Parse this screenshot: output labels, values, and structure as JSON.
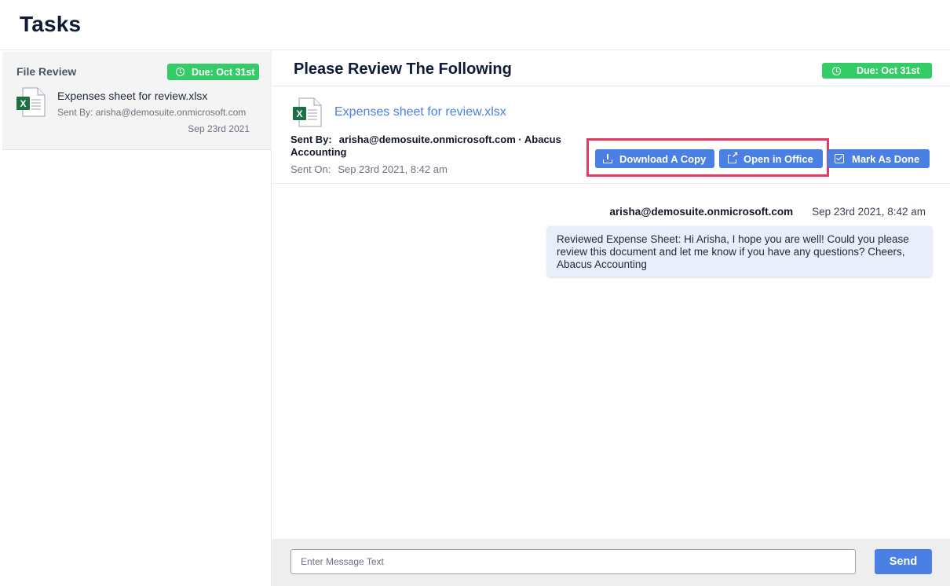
{
  "page": {
    "title": "Tasks"
  },
  "colors": {
    "accent": "#4a7fe4",
    "due_badge": "#33cc66",
    "highlight": "#e63765",
    "bubble": "#e8effa",
    "excel_green": "#1d7044"
  },
  "sidebar": {
    "tasks": [
      {
        "category": "File Review",
        "due": "Due: Oct 31st",
        "file_name": "Expenses sheet for review.xlsx",
        "sender": "Sent By: arisha@demosuite.onmicrosoft.com",
        "date": "Sep 23rd 2021",
        "icon": "excel-file-icon"
      }
    ]
  },
  "main": {
    "title": "Please Review The Following",
    "due": "Due: Oct 31st",
    "file": {
      "name": "Expenses sheet for review.xlsx",
      "icon": "excel-file-icon",
      "sent_by_label": "Sent By:",
      "sent_by_value": "arisha@demosuite.onmicrosoft.com · Abacus Accounting",
      "sent_on_label": "Sent On:",
      "sent_on_value": "Sep 23rd 2021, 8:42 am"
    },
    "actions": {
      "download": "Download A Copy",
      "open_office": "Open in Office",
      "mark_done": "Mark As Done"
    },
    "messages": [
      {
        "sender": "arisha@demosuite.onmicrosoft.com",
        "time": "Sep 23rd 2021, 8:42 am",
        "text": "Reviewed Expense Sheet: Hi Arisha, I hope you are well! Could you please review this document and let me know if you have any questions? Cheers, Abacus Accounting"
      }
    ],
    "composer": {
      "placeholder": "Enter Message Text",
      "value": "",
      "send_label": "Send"
    }
  }
}
